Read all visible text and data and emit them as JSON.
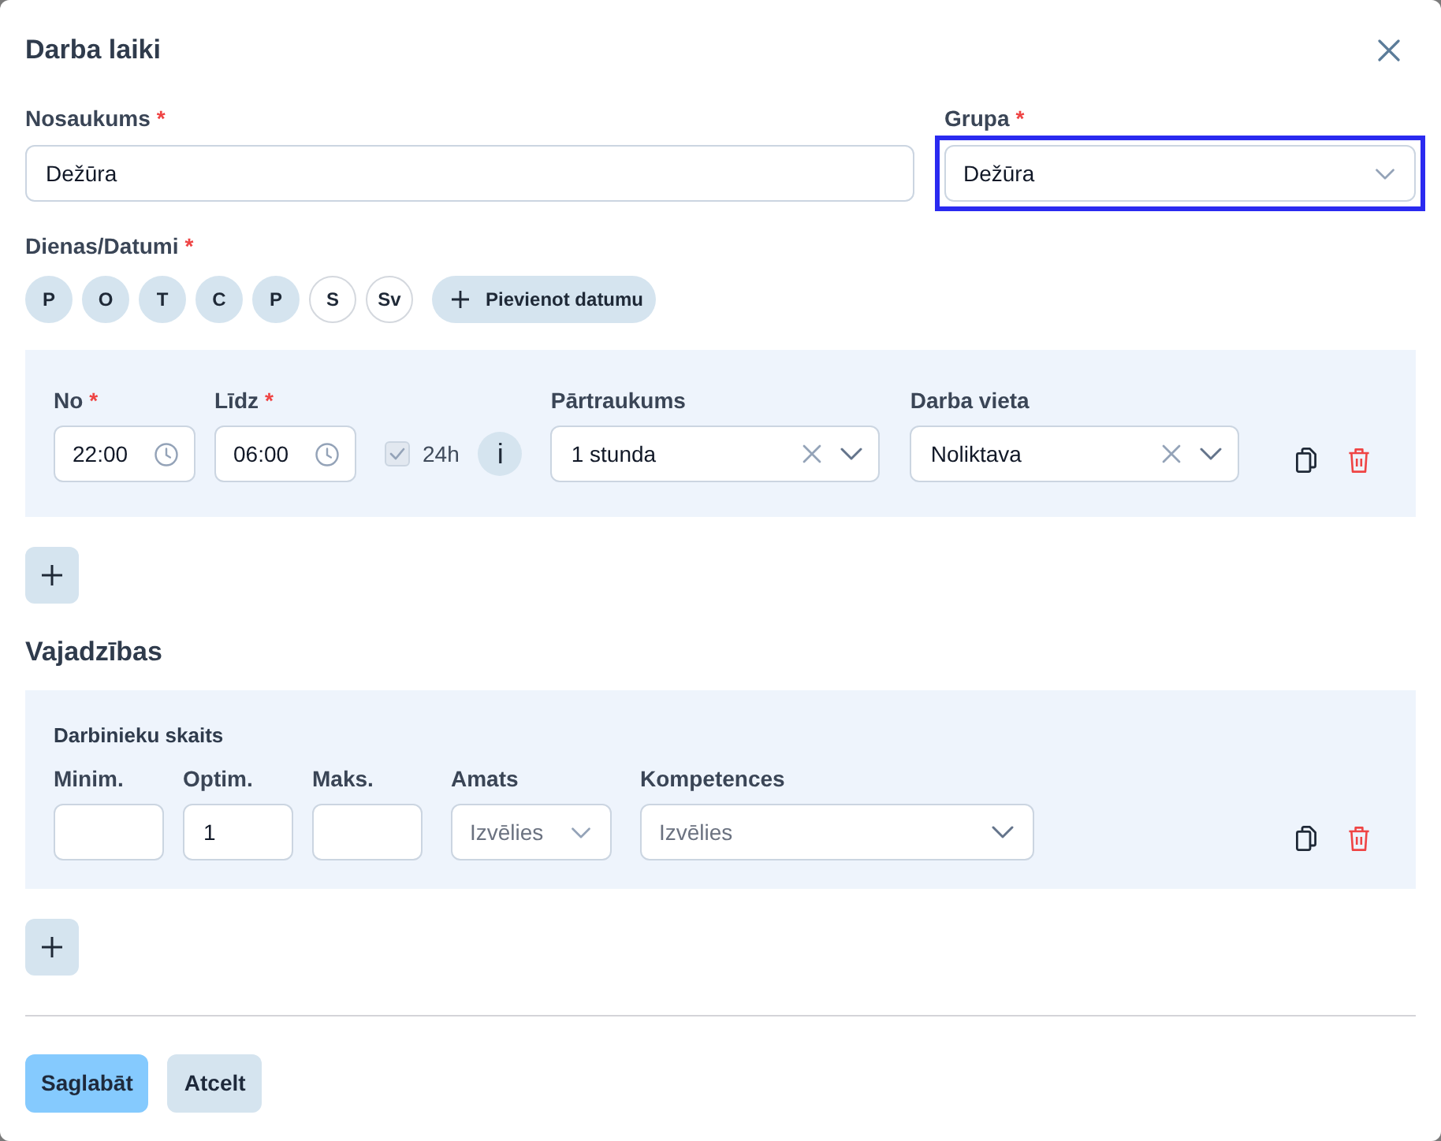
{
  "dialog": {
    "title": "Darba laiki"
  },
  "fields": [
    {
      "kind": "text",
      "label": "Nosaukums",
      "required_mark": "*",
      "value": "Dežūra",
      "focused": false
    },
    {
      "kind": "select",
      "label": "Grupa",
      "required_mark": "*",
      "value": "Dežūra",
      "focused": true
    }
  ],
  "days": {
    "label": "Dienas/Datumi",
    "required_mark": "*",
    "items": [
      {
        "label": "P",
        "selected": true
      },
      {
        "label": "O",
        "selected": true
      },
      {
        "label": "T",
        "selected": true
      },
      {
        "label": "C",
        "selected": true
      },
      {
        "label": "P",
        "selected": true
      },
      {
        "label": "S",
        "selected": false
      },
      {
        "label": "Sv",
        "selected": false
      }
    ],
    "add_button": "Pievienot datumu"
  },
  "shifts": [
    {
      "from": {
        "label": "No",
        "required_mark": "*",
        "value": "22:00"
      },
      "to": {
        "label": "Līdz",
        "required_mark": "*",
        "value": "06:00"
      },
      "all_day": {
        "label": "24h",
        "checked": true,
        "disabled": true
      },
      "info_button": "i",
      "break": {
        "label": "Pārtraukums",
        "value": "1 stunda"
      },
      "workplace": {
        "label": "Darba vieta",
        "value": "Noliktava"
      }
    }
  ],
  "needs": {
    "title": "Vajadzības",
    "items": [
      {
        "group_label": "Darbinieku skaits",
        "minimum": {
          "label": "Minim."
        },
        "optimum": {
          "label": "Optim.",
          "value": "1"
        },
        "maximum": {
          "label": "Maks."
        },
        "position": {
          "label": "Amats",
          "placeholder": "Izvēlies"
        },
        "competences": {
          "label": "Kompetences",
          "placeholder": "Izvēlies"
        }
      }
    ]
  },
  "footer_buttons": [
    {
      "kind": "primary",
      "label": "Saglabāt"
    },
    {
      "kind": "secondary",
      "label": "Atcelt"
    }
  ]
}
